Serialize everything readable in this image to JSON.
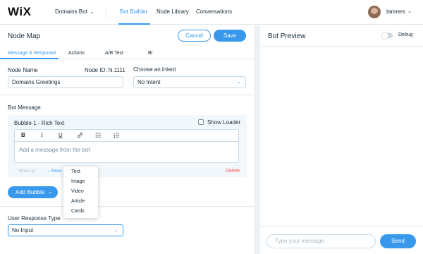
{
  "header": {
    "logo": "WiX",
    "site_selector": "Domains Bot",
    "nav": [
      "Bot Builder",
      "Node Library",
      "Conversations"
    ],
    "active_nav": "Bot Builder",
    "username": "tanners"
  },
  "node_map": {
    "title": "Node Map",
    "cancel_label": "Cancel",
    "save_label": "Save",
    "tabs": [
      "Message & Response",
      "Actions",
      "A/B Test",
      "BI"
    ],
    "active_tab": "Message & Response",
    "node_name_label": "Node Name",
    "node_id": "Node ID: N.1111",
    "node_name_value": "Domains Greetings",
    "intent_label": "Choose an intent",
    "intent_value": "No Intent",
    "bot_message_label": "Bot Message",
    "bubble_title": "Bubble 1 - Rich Text",
    "show_loader_label": "Show Loader",
    "toolbar": {
      "bold": "B",
      "italic": "I",
      "underline": "U"
    },
    "editor_placeholder": "Add a message from the bot",
    "move_up": "Move up",
    "move_down": "Move",
    "delete_label": "Delete",
    "add_bubble_label": "Add Bubble",
    "bubble_menu": [
      "Text",
      "Image",
      "Video",
      "Article",
      "Cards"
    ],
    "user_response_label": "User Response Type",
    "user_response_value": "No Input"
  },
  "bot_preview": {
    "title": "Bot Preview",
    "debug_label": "Debug",
    "debug_on": false,
    "message_placeholder": "Type your message",
    "send_label": "Send"
  },
  "colors": {
    "accent": "#3899ec",
    "danger": "#ee5951",
    "text": "#20303c",
    "panel_bg": "#f2f7fc"
  }
}
